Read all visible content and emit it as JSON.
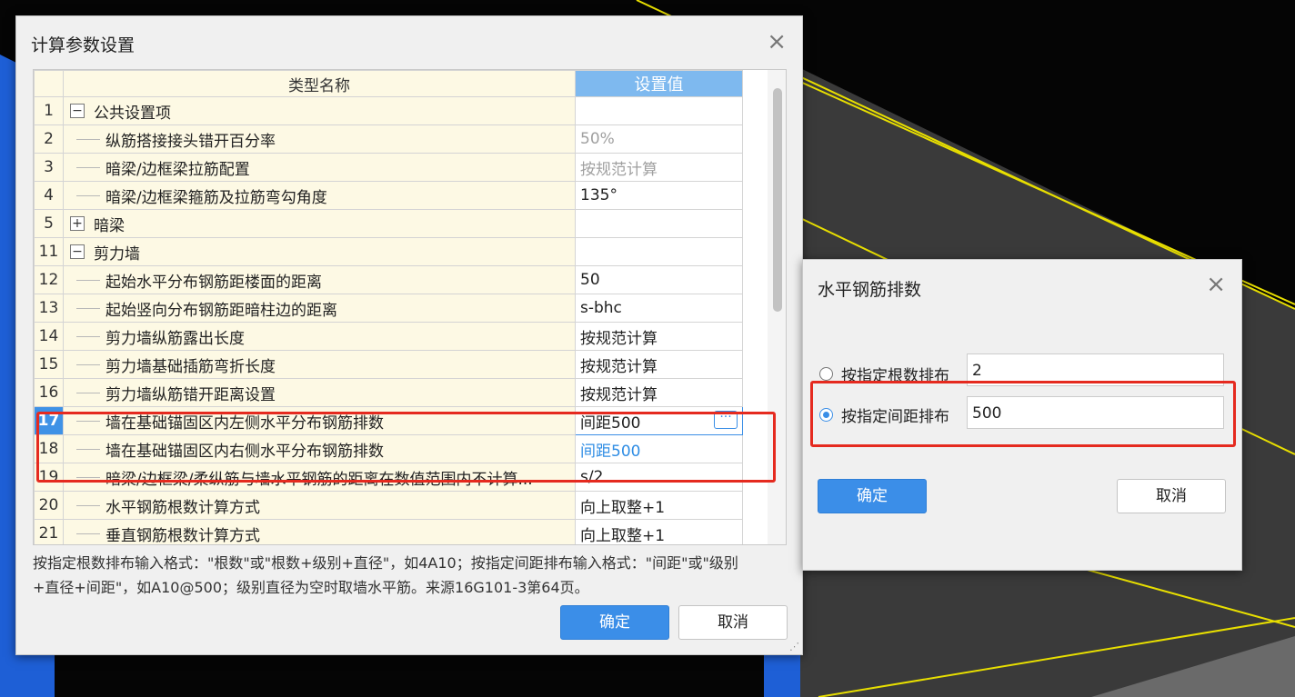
{
  "main_dialog": {
    "title": "计算参数设置",
    "close_symbol": "×",
    "columns": {
      "row_no": "",
      "name": "类型名称",
      "value": "设置值"
    },
    "rows": [
      {
        "no": "1",
        "name": "公共设置项",
        "value": "",
        "toggle": "−",
        "kind": "group"
      },
      {
        "no": "2",
        "name": "纵筋搭接接头错开百分率",
        "value": "50%",
        "kind": "item",
        "style": "gray"
      },
      {
        "no": "3",
        "name": "暗梁/边框梁拉筋配置",
        "value": "按规范计算",
        "kind": "item",
        "style": "gray"
      },
      {
        "no": "4",
        "name": "暗梁/边框梁箍筋及拉筋弯勾角度",
        "value": "135°",
        "kind": "item"
      },
      {
        "no": "5",
        "name": "暗梁",
        "value": "",
        "toggle": "+",
        "kind": "group"
      },
      {
        "no": "11",
        "name": "剪力墙",
        "value": "",
        "toggle": "−",
        "kind": "group"
      },
      {
        "no": "12",
        "name": "起始水平分布钢筋距楼面的距离",
        "value": "50",
        "kind": "item"
      },
      {
        "no": "13",
        "name": "起始竖向分布钢筋距暗柱边的距离",
        "value": "s-bhc",
        "kind": "item"
      },
      {
        "no": "14",
        "name": "剪力墙纵筋露出长度",
        "value": "按规范计算",
        "kind": "item"
      },
      {
        "no": "15",
        "name": "剪力墙基础插筋弯折长度",
        "value": "按规范计算",
        "kind": "item"
      },
      {
        "no": "16",
        "name": "剪力墙纵筋错开距离设置",
        "value": "按规范计算",
        "kind": "item"
      },
      {
        "no": "17",
        "name": "墙在基础锚固区内左侧水平分布钢筋排数",
        "value": "间距500",
        "kind": "item",
        "style": "editing",
        "active": true
      },
      {
        "no": "18",
        "name": "墙在基础锚固区内右侧水平分布钢筋排数",
        "value": "间距500",
        "kind": "item",
        "style": "blue"
      },
      {
        "no": "19",
        "name": "暗梁/边框梁/柔纵筋与墙水平钢筋的距离在数值范围内不计算...",
        "value": "s/2",
        "kind": "item"
      },
      {
        "no": "20",
        "name": "水平钢筋根数计算方式",
        "value": "向上取整+1",
        "kind": "item"
      },
      {
        "no": "21",
        "name": "垂直钢筋根数计算方式",
        "value": "向上取整+1",
        "kind": "item"
      }
    ],
    "edit_button_symbol": "···",
    "description": "按指定根数排布输入格式：\"根数\"或\"根数+级别+直径\"，如4A10；按指定间距排布输入格式：\"间距\"或\"级别+直径+间距\"，如A10@500；级别直径为空时取墙水平筋。来源16G101-3第64页。",
    "ok_label": "确定",
    "cancel_label": "取消"
  },
  "sub_dialog": {
    "title": "水平钢筋排数",
    "close_symbol": "×",
    "option_count_label": "按指定根数排布",
    "option_count_value": "2",
    "option_count_checked": false,
    "option_spacing_label": "按指定间距排布",
    "option_spacing_value": "500",
    "option_spacing_checked": true,
    "ok_label": "确定",
    "cancel_label": "取消"
  },
  "colors": {
    "highlight_red": "#e52a1f",
    "accent_blue": "#3b8ee8",
    "header_blue": "#7eb9ef",
    "row_cream": "#fdf9e4",
    "background_yellow_line": "#e8df00"
  }
}
